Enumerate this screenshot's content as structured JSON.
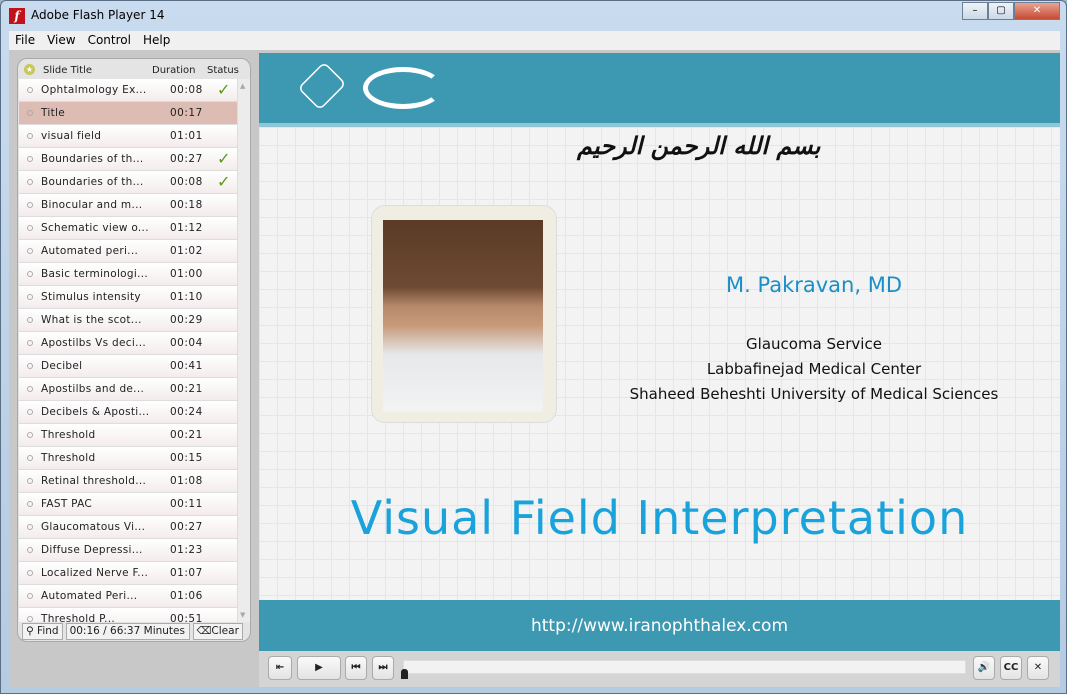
{
  "window": {
    "title": "Adobe Flash Player 14",
    "buttons": [
      "–",
      "▢",
      "✕"
    ]
  },
  "menu": [
    "File",
    "View",
    "Control",
    "Help"
  ],
  "sidebar": {
    "headers": {
      "title": "Slide Title",
      "duration": "Duration",
      "status": "Status"
    },
    "selected_index": 1,
    "rows": [
      {
        "title": "Ophtalmology Ex...",
        "duration": "00:08",
        "status": "✓"
      },
      {
        "title": "Title",
        "duration": "00:17",
        "status": ""
      },
      {
        "title": "visual field",
        "duration": "01:01",
        "status": ""
      },
      {
        "title": "Boundaries of th...",
        "duration": "00:27",
        "status": "✓"
      },
      {
        "title": "Boundaries of th...",
        "duration": "00:08",
        "status": "✓"
      },
      {
        "title": "Binocular and m...",
        "duration": "00:18",
        "status": ""
      },
      {
        "title": "Schematic view o...",
        "duration": "01:12",
        "status": ""
      },
      {
        "title": "Automated peri...",
        "duration": "01:02",
        "status": ""
      },
      {
        "title": "Basic terminologi...",
        "duration": "01:00",
        "status": ""
      },
      {
        "title": "Stimulus intensity",
        "duration": "01:10",
        "status": ""
      },
      {
        "title": "What is the scot...",
        "duration": "00:29",
        "status": ""
      },
      {
        "title": "Apostilbs Vs deci...",
        "duration": "00:04",
        "status": ""
      },
      {
        "title": "Decibel",
        "duration": "00:41",
        "status": ""
      },
      {
        "title": "Apostilbs and de...",
        "duration": "00:21",
        "status": ""
      },
      {
        "title": "Decibels & Aposti...",
        "duration": "00:24",
        "status": ""
      },
      {
        "title": "Threshold",
        "duration": "00:21",
        "status": ""
      },
      {
        "title": "Threshold",
        "duration": "00:15",
        "status": ""
      },
      {
        "title": "Retinal threshold...",
        "duration": "01:08",
        "status": ""
      },
      {
        "title": "FAST PAC",
        "duration": "00:11",
        "status": ""
      },
      {
        "title": "Glaucomatous Vi...",
        "duration": "00:27",
        "status": ""
      },
      {
        "title": "Diffuse Depressi...",
        "duration": "01:23",
        "status": ""
      },
      {
        "title": "Localized Nerve F...",
        "duration": "01:07",
        "status": ""
      },
      {
        "title": "Automated Peri...",
        "duration": "01:06",
        "status": ""
      },
      {
        "title": "Threshold P...",
        "duration": "00:51",
        "status": ""
      }
    ],
    "find_label": "Find",
    "time": "00:16 / 66:37 Minutes",
    "clear_label": "Clear"
  },
  "slide": {
    "bismillah": "بسم الله الرحمن الرحيم",
    "name": "M. Pakravan, MD",
    "affiliation": [
      "Glaucoma Service",
      "Labbafinejad Medical Center",
      "Shaheed Beheshti University of Medical Sciences"
    ],
    "title": "Visual Field Interpretation",
    "url": "http://www.iranophthalex.com",
    "colors": {
      "band": "#3d99b2",
      "title": "#1aa3db"
    }
  },
  "controls": {
    "play": "▶",
    "prev": "⏮",
    "next": "⏭",
    "exit": "⇤",
    "volume": "🔊",
    "cc": "CC",
    "close": "✕",
    "progress": 0.0
  }
}
